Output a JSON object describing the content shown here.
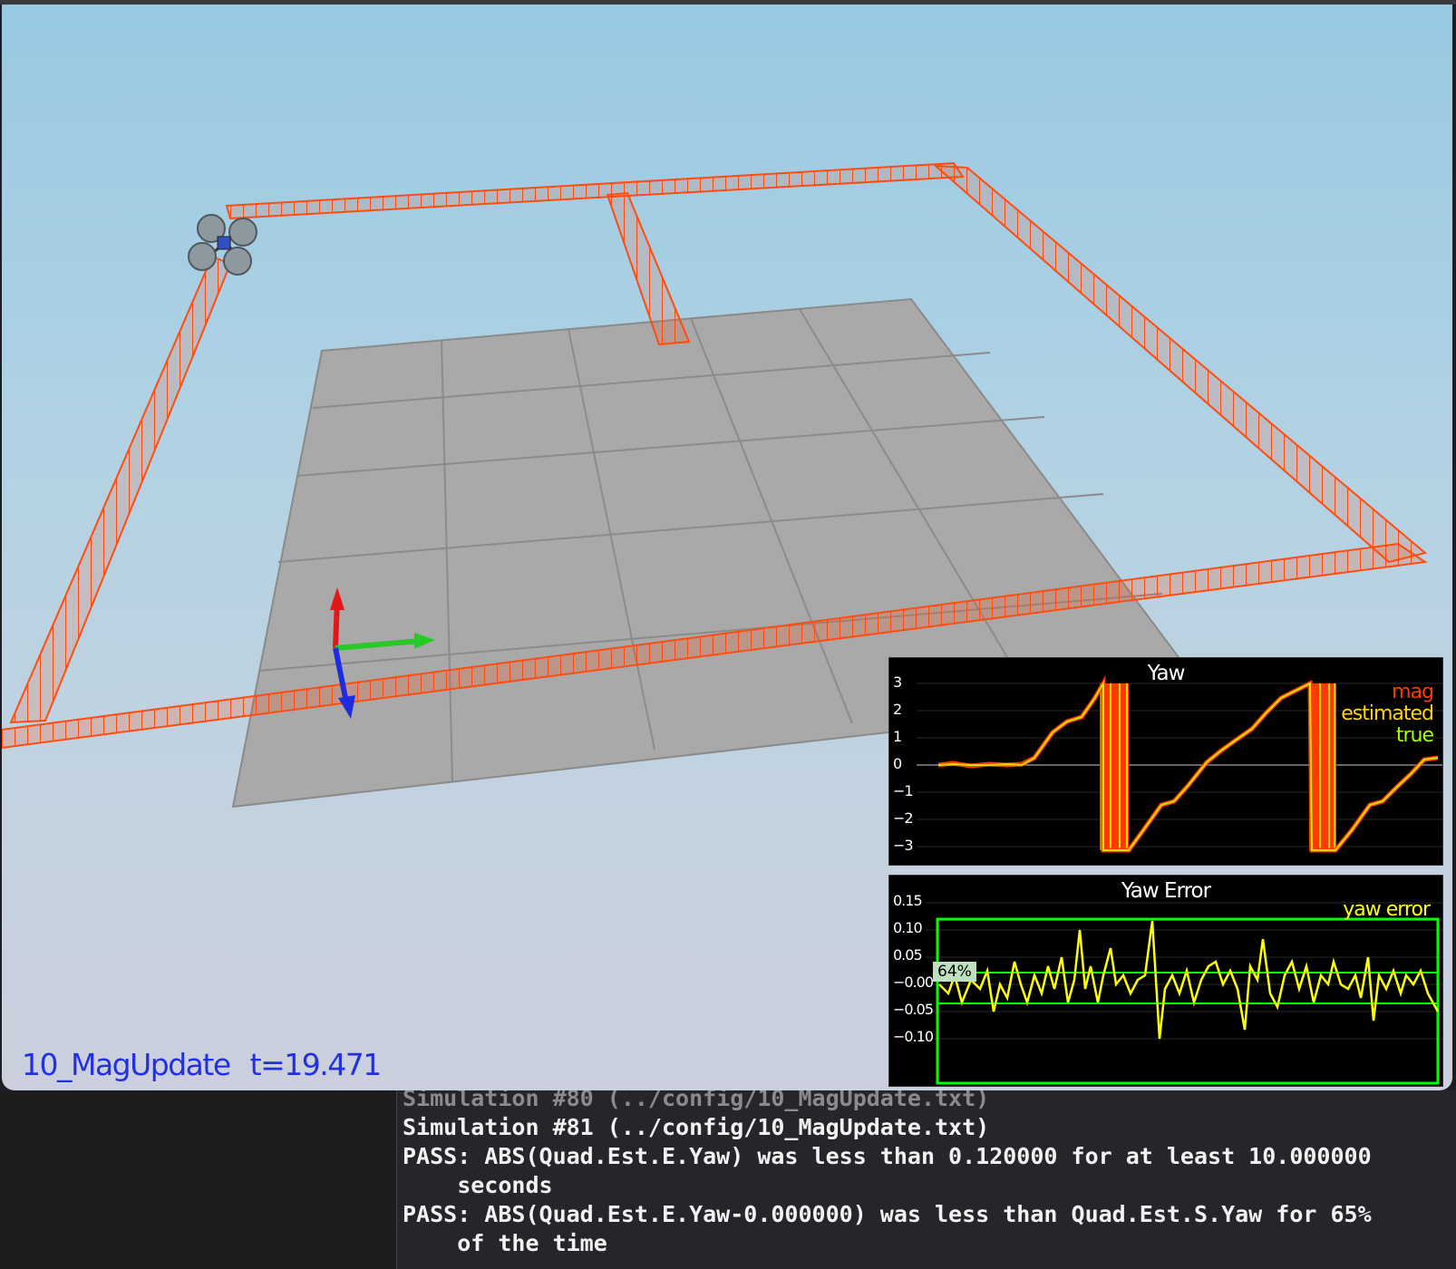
{
  "window": {
    "scenario": "10_MagUpdate",
    "time": "t=19.471"
  },
  "colors": {
    "trajectory": "#ff4c10",
    "mag": "#ff3a00",
    "estimated": "#ffd400",
    "true_line": "#a0ff00",
    "yaw_error": "#ffff00",
    "bound": "#00ff00",
    "status_text": "#2330e0"
  },
  "icons": {
    "drone": "quadcopter-icon",
    "axes": "coordinate-axes-icon"
  },
  "yaw_plot": {
    "title": "Yaw",
    "legend": [
      "mag",
      "estimated",
      "true"
    ],
    "yticks": [
      "3",
      "2",
      "1",
      "0",
      "−1",
      "−2",
      "−3"
    ]
  },
  "yaw_error_plot": {
    "title": "Yaw Error",
    "legend": [
      "yaw error"
    ],
    "yticks": [
      "0.15",
      "0.10",
      "0.05",
      "−0.00",
      "−0.05",
      "−0.10"
    ],
    "percent_badge": "64%"
  },
  "terminal": {
    "lines": [
      "Simulation #80 (../config/10_MagUpdate.txt)",
      "Simulation #81 (../config/10_MagUpdate.txt)",
      "PASS: ABS(Quad.Est.E.Yaw) was less than 0.120000 for at least 10.000000",
      "    seconds",
      "PASS: ABS(Quad.Est.E.Yaw-0.000000) was less than Quad.Est.S.Yaw for 65%",
      "    of the time"
    ]
  }
}
